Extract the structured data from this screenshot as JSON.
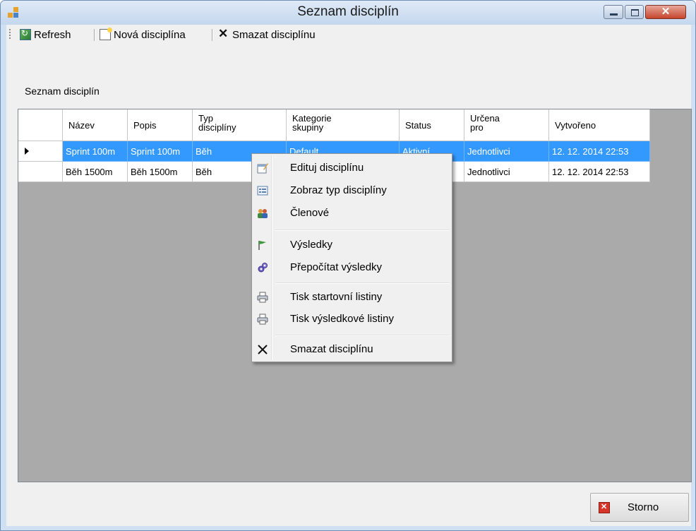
{
  "window": {
    "title": "Seznam disciplín",
    "buttons": [
      "minimize",
      "maximize",
      "close"
    ]
  },
  "toolbar": {
    "items": [
      {
        "label": "Refresh",
        "icon": "refresh-icon"
      },
      {
        "label": "Nová disciplína",
        "icon": "new-document-icon"
      },
      {
        "label": "Smazat disciplínu",
        "icon": "delete-x-icon"
      }
    ]
  },
  "section": {
    "label": "Seznam disciplín"
  },
  "grid": {
    "columns": [
      {
        "label": "Název"
      },
      {
        "label": "Popis"
      },
      {
        "label": "Typ\ndisciplíny"
      },
      {
        "label": "Kategorie\nskupiny"
      },
      {
        "label": "Status"
      },
      {
        "label": "Určena\npro"
      },
      {
        "label": "Vytvořeno"
      }
    ],
    "rows": [
      {
        "selected": true,
        "cells": [
          "Sprint 100m",
          "Sprint 100m",
          "Běh",
          "Default",
          "Aktivní",
          "Jednotlivci",
          "12. 12. 2014 22:53"
        ]
      },
      {
        "selected": false,
        "cells": [
          "Běh 1500m",
          "Běh 1500m",
          "Běh",
          "",
          "",
          "Jednotlivci",
          "12. 12. 2014 22:53"
        ]
      }
    ]
  },
  "context_menu": {
    "items": [
      {
        "label": "Edituj disciplínu",
        "icon": "edit-icon"
      },
      {
        "label": "Zobraz typ disciplíny",
        "icon": "view-icon"
      },
      {
        "label": "Členové",
        "icon": "members-icon"
      },
      {
        "label": "Výsledky",
        "icon": "flag-icon"
      },
      {
        "label": "Přepočítat výsledky",
        "icon": "recalculate-icon"
      },
      {
        "label": "Tisk startovní listiny",
        "icon": "print-icon"
      },
      {
        "label": "Tisk výsledkové listiny",
        "icon": "print-icon"
      },
      {
        "label": "Smazat disciplínu",
        "icon": "delete-x-icon"
      }
    ]
  },
  "footer": {
    "cancel_label": "Storno",
    "cancel_icon": "cancel-icon"
  },
  "colors": {
    "selection": "#3399ff",
    "grid_background": "#aaaaaa",
    "window_frame": "#cfe0f3"
  }
}
